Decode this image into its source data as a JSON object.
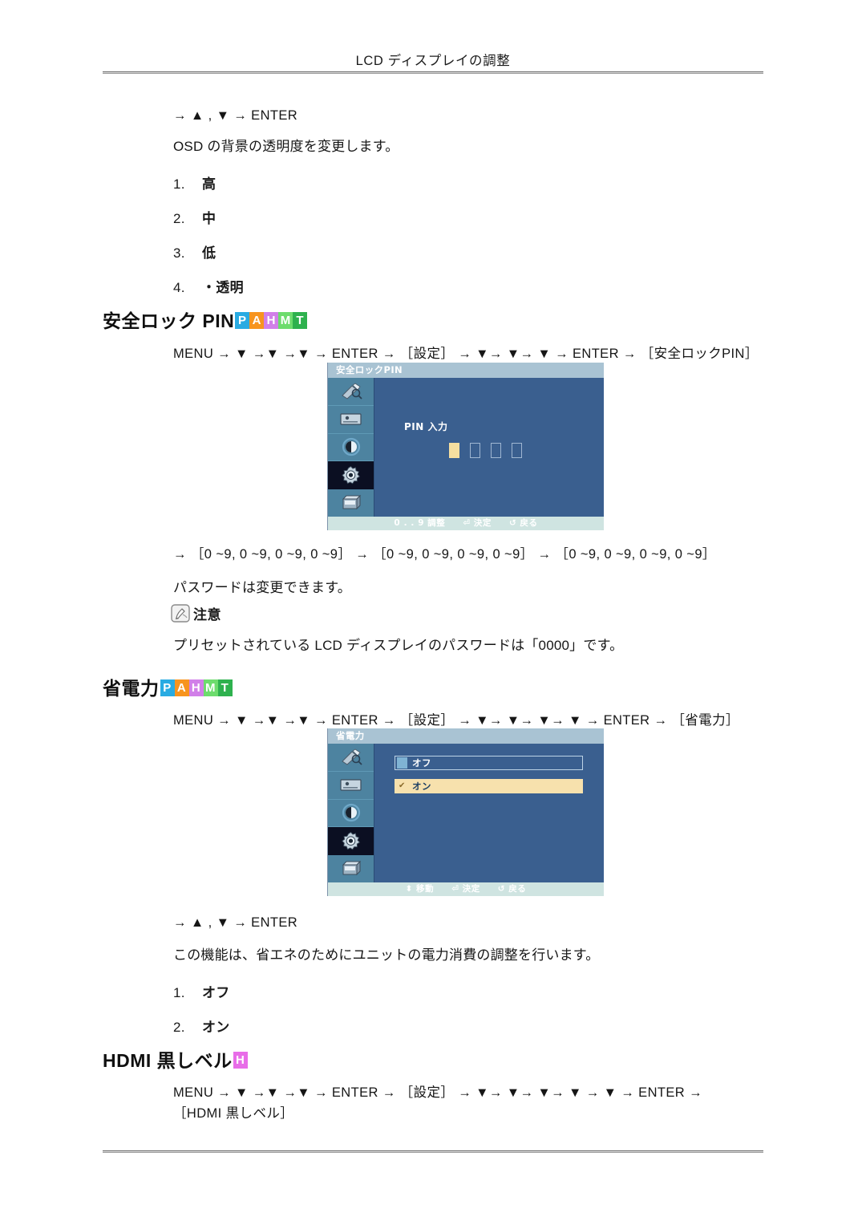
{
  "page": {
    "running_head": "LCD ディスプレイの調整"
  },
  "top_section": {
    "nav_line": "→ ▲ , ▼ → ENTER",
    "description": "OSD の背景の透明度を変更します。",
    "options": [
      {
        "index": "1.",
        "label": "高"
      },
      {
        "index": "2.",
        "label": "中"
      },
      {
        "index": "3.",
        "label": "低"
      },
      {
        "index": "4.",
        "label": "・透明"
      }
    ]
  },
  "section_pin": {
    "heading": "安全ロック PIN",
    "badges": [
      {
        "letter": "P",
        "color": "#29abe2"
      },
      {
        "letter": "A",
        "color": "#f7941e"
      },
      {
        "letter": "H",
        "color": "#d17fe8"
      },
      {
        "letter": "M",
        "color": "#6ddc6d"
      },
      {
        "letter": "T",
        "color": "#2eb14e"
      }
    ],
    "menu_path": "MENU → ▼ →▼ →▼ → ENTER → ［設定］ → ▼→ ▼→ ▼ → ENTER → ［安全ロックPIN］",
    "menu_tokens": {
      "menu": "MENU",
      "enter": "ENTER",
      "bracket_settings": "［設定］",
      "bracket_target": "［安全ロックPIN］"
    },
    "osd": {
      "title": "安全ロックPIN",
      "pin_label": "PIN 入力",
      "pin_digits": [
        "filled",
        "empty",
        "empty",
        "empty"
      ],
      "footer": [
        {
          "icon": "digits-icon",
          "glyph": "0 . . 9",
          "label": "調整"
        },
        {
          "icon": "enter-icon",
          "glyph": "⏎",
          "label": "決定"
        },
        {
          "icon": "return-icon",
          "glyph": "↺",
          "label": "戻る"
        }
      ],
      "sidebar_icons": [
        "picture-icon",
        "screen-icon",
        "contrast-icon",
        "setup-gear-icon",
        "multi-display-icon"
      ],
      "selected_sidebar_index": 3
    },
    "range_line": "→ ［0 ~9,  0 ~9,  0 ~9,  0 ~9］ → ［0 ~9,  0 ~9,  0 ~9,  0 ~9］ → ［0 ~9,  0 ~9,  0 ~9,  0 ~9］",
    "password_note": "パスワードは変更できます。",
    "caution_label": "注意",
    "caution_text": "プリセットされている LCD ディスプレイのパスワードは「0000」です。"
  },
  "section_power": {
    "heading": "省電力",
    "badges": [
      {
        "letter": "P",
        "color": "#29abe2"
      },
      {
        "letter": "A",
        "color": "#f7941e"
      },
      {
        "letter": "H",
        "color": "#d17fe8"
      },
      {
        "letter": "M",
        "color": "#6ddc6d"
      },
      {
        "letter": "T",
        "color": "#2eb14e"
      }
    ],
    "menu_path": "MENU → ▼ →▼ →▼ → ENTER → ［設定］ → ▼→ ▼→ ▼→ ▼ → ENTER → ［省電力］",
    "osd": {
      "title": "省電力",
      "options": [
        {
          "label": "オフ",
          "selected": false
        },
        {
          "label": "オン",
          "selected": true
        }
      ],
      "footer": [
        {
          "icon": "updown-icon",
          "glyph": "⬍",
          "label": "移動"
        },
        {
          "icon": "enter-icon",
          "glyph": "⏎",
          "label": "決定"
        },
        {
          "icon": "return-icon",
          "glyph": "↺",
          "label": "戻る"
        }
      ],
      "sidebar_icons": [
        "picture-icon",
        "screen-icon",
        "contrast-icon",
        "setup-gear-icon",
        "multi-display-icon"
      ],
      "selected_sidebar_index": 3
    },
    "nav_line": "→ ▲ , ▼ → ENTER",
    "description": "この機能は、省エネのためにユニットの電力消費の調整を行います。",
    "options": [
      {
        "index": "1.",
        "label": "オフ"
      },
      {
        "index": "2.",
        "label": "オン"
      }
    ]
  },
  "section_hdmi": {
    "heading": "HDMI 黒しベル",
    "badges": [
      {
        "letter": "H",
        "color": "#e86de8"
      }
    ],
    "menu_path_line1": "MENU → ▼ →▼ →▼ → ENTER → ［設定］ → ▼→ ▼→ ▼→ ▼ → ▼ → ENTER →",
    "menu_path_line2": "［HDMI 黒しベル］"
  }
}
